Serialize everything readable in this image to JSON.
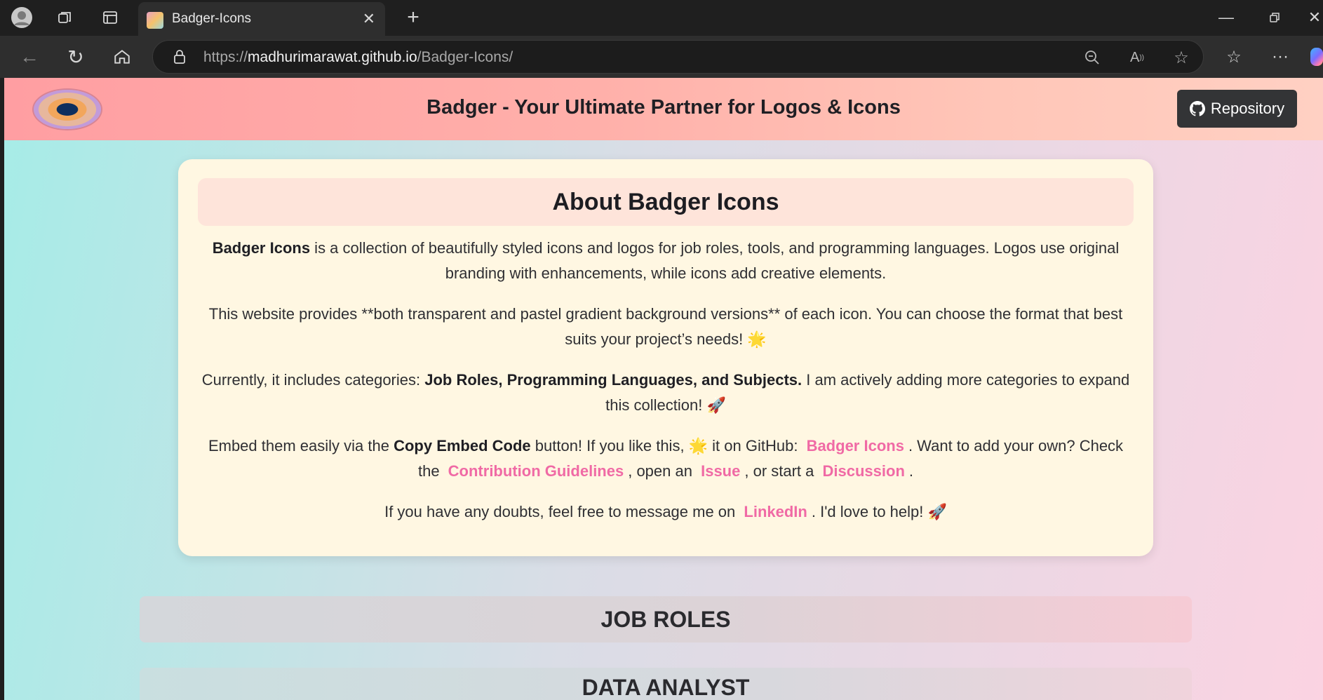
{
  "browser": {
    "tab_title": "Badger-Icons",
    "url_scheme": "https://",
    "url_host": "madhurimarawat.github.io",
    "url_path": "/Badger-Icons/"
  },
  "header": {
    "title": "Badger - Your Ultimate Partner for Logos & Icons",
    "repo_label": "Repository"
  },
  "about": {
    "heading": "About Badger Icons",
    "p1": {
      "bold": "Badger Icons",
      "text": " is a collection of beautifully styled icons and logos for job roles, tools, and programming languages. Logos use original branding with enhancements, while icons add creative elements."
    },
    "p2": {
      "text": "This website provides **both transparent and pastel gradient background versions** of each icon. You can choose the format that best suits your project’s needs! 🌟"
    },
    "p3": {
      "prefix": "Currently, it includes categories: ",
      "bold": "Job Roles, Programming Languages, and Subjects.",
      "suffix": " I am actively adding more categories to expand this collection! 🚀"
    },
    "p4": {
      "t1": "Embed them easily via the ",
      "bold": "Copy Embed Code",
      "t2": " button! If you like this, 🌟 it on GitHub: ",
      "link1": "Badger Icons",
      "t3": ". Want to add your own? Check the ",
      "link2": "Contribution Guidelines",
      "t4": ", open an ",
      "link3": "Issue",
      "t5": ", or start a ",
      "link4": "Discussion",
      "t6": "."
    },
    "p5": {
      "t1": "If you have any doubts, feel free to message me on ",
      "link": "LinkedIn",
      "t2": ". I'd love to help! 🚀"
    }
  },
  "sections": {
    "job_roles": "JOB ROLES",
    "data_analyst": "DATA ANALYST"
  },
  "colors": {
    "link": "#f06aa5",
    "card_bg": "#fff7e2",
    "header_gradient_start": "#ff9ea2"
  }
}
